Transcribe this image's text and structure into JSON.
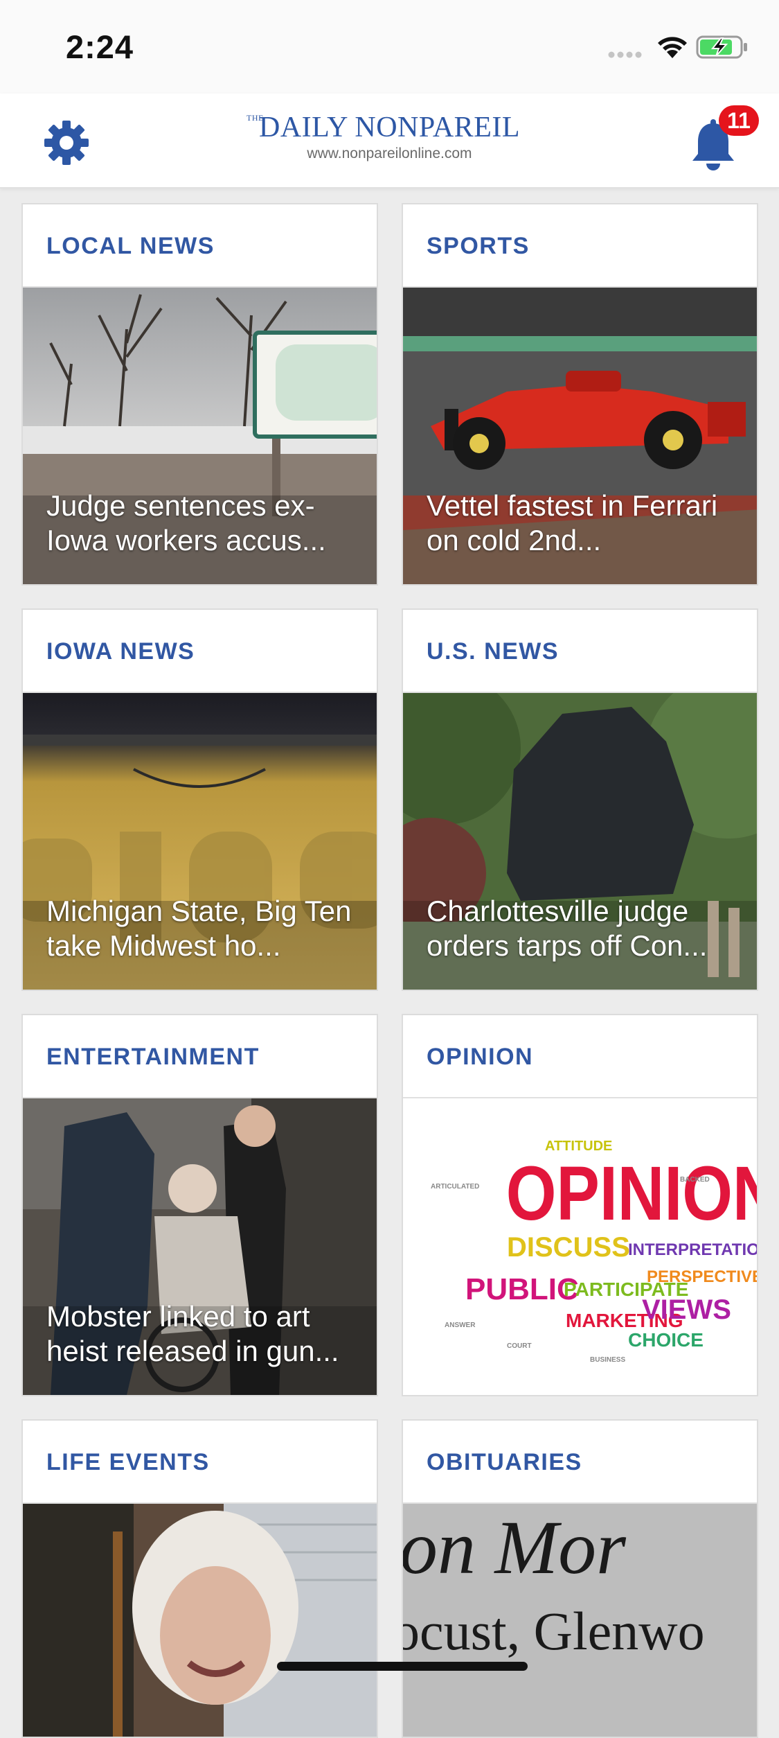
{
  "status_bar": {
    "time": "2:24"
  },
  "header": {
    "brand_the": "THE",
    "brand_name": "DAILY NONPAREIL",
    "brand_url": "www.nonpareilonline.com",
    "notification_count": "11",
    "icons": [
      "gear-icon",
      "bell-icon"
    ]
  },
  "sections": [
    {
      "title": "LOCAL NEWS",
      "headline": "Judge sentences ex-Iowa workers accus..."
    },
    {
      "title": "SPORTS",
      "headline": "Vettel fastest in Ferrari on cold 2nd..."
    },
    {
      "title": "IOWA NEWS",
      "headline": "Michigan State, Big Ten take Midwest ho..."
    },
    {
      "title": "U.S. NEWS",
      "headline": "Charlottesville judge orders tarps off Con..."
    },
    {
      "title": "ENTERTAINMENT",
      "headline": "Mobster linked to art heist released in gun..."
    },
    {
      "title": "OPINION",
      "headline": "",
      "image_words": [
        "OPINION",
        "DISCUSS",
        "PUBLIC",
        "PARTICIPATE",
        "VIEWS",
        "CHOICE",
        "ATTITUDE",
        "MARKETING",
        "PERSPECTIVE",
        "INTERPRETATION"
      ]
    },
    {
      "title": "LIFE EVENTS",
      "headline": ""
    },
    {
      "title": "OBITUARIES",
      "headline": "",
      "image_text": [
        "on Mor",
        "ocust, Glenwo"
      ]
    }
  ],
  "colors": {
    "brand_blue": "#2d57a5",
    "badge_red": "#e5141c"
  }
}
